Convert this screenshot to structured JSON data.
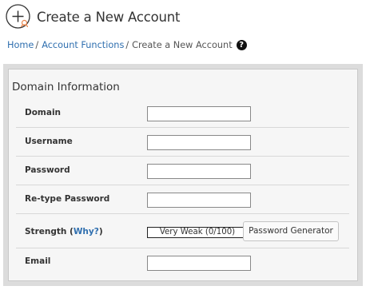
{
  "header": {
    "title": "Create a New Account",
    "icon": "add-circle-icon"
  },
  "breadcrumb": {
    "items": [
      "Home",
      "Account Functions"
    ],
    "current": "Create a New Account",
    "separator": "/",
    "help_glyph": "?"
  },
  "section": {
    "title": "Domain Information"
  },
  "form": {
    "domain_label": "Domain",
    "domain_value": "",
    "username_label": "Username",
    "username_value": "",
    "password_label": "Password",
    "password_value": "",
    "retype_label": "Re-type Password",
    "retype_value": "",
    "strength_label": "Strength",
    "strength_open": "(",
    "strength_link": "Why?",
    "strength_close": ")",
    "strength_value": "Very Weak (0/100)",
    "generator_button": "Password Generator",
    "email_label": "Email",
    "email_value": ""
  },
  "colors": {
    "link": "#2f6faf",
    "panel_bg": "#f6f6f6",
    "outer_bg": "#dcdcdc",
    "accent_icon": "#e8834a"
  }
}
